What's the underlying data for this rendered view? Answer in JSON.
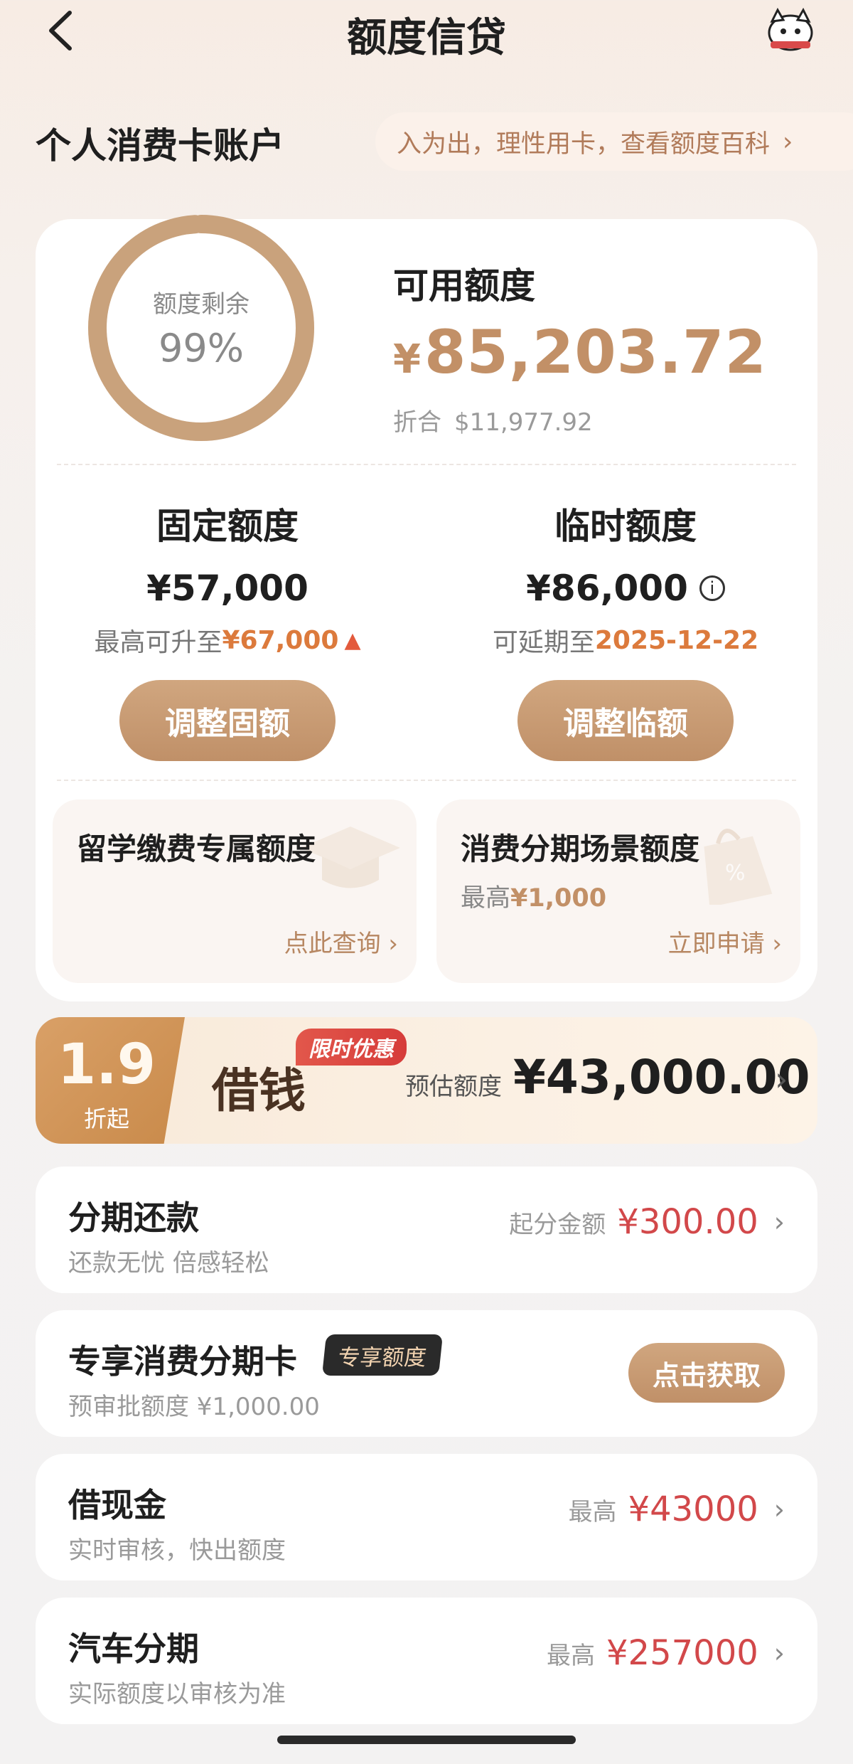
{
  "header": {
    "title": "额度信贷"
  },
  "account": {
    "section_title": "个人消费卡账户",
    "tip": "入为出，理性用卡，查看额度百科",
    "ring": {
      "label": "额度剩余",
      "value": "99%",
      "fraction": 0.99
    },
    "available": {
      "title": "可用额度",
      "currency": "¥",
      "amount": "85,203.72",
      "usd_label": "折合",
      "usd_amount": "$11,977.92"
    },
    "fixed": {
      "title": "固定额度",
      "amount": "¥57,000",
      "sub_prefix": "最高可升至",
      "sub_value": "¥67,000",
      "button": "调整固额"
    },
    "temporary": {
      "title": "临时额度",
      "amount": "¥86,000",
      "sub_prefix": "可延期至",
      "sub_value": "2025-12-22",
      "button": "调整临额"
    },
    "study": {
      "title": "留学缴费专属额度",
      "link": "点此查询"
    },
    "installment_scene": {
      "title": "消费分期场景额度",
      "sub_prefix": "最高",
      "sub_value": "¥1,000",
      "link": "立即申请"
    }
  },
  "loan_banner": {
    "rate": "1.9",
    "rate_sub": "折起",
    "title": "借钱",
    "tag": "限时优惠",
    "est_label": "预估额度",
    "amount": "¥43,000.00"
  },
  "rows": [
    {
      "title": "分期还款",
      "sub": "还款无忧 倍感轻松",
      "right_label": "起分金额",
      "right_value": "¥300.00"
    },
    {
      "title": "专享消费分期卡",
      "tag": "专享额度",
      "sub": "预审批额度 ¥1,000.00",
      "button": "点击获取"
    },
    {
      "title": "借现金",
      "sub": "实时审核，快出额度",
      "right_label": "最高",
      "right_value": "¥43000"
    },
    {
      "title": "汽车分期",
      "sub": "实际额度以审核为准",
      "right_label": "最高",
      "right_value": "¥257000"
    }
  ],
  "colors": {
    "accent": "#c29067",
    "highlight": "#dc7a3c",
    "red": "#d2484a"
  },
  "icons": {
    "back": "chevron-left-icon",
    "mascot": "mascot-icon",
    "info": "info-icon",
    "up": "arrow-up-icon",
    "chevron": "chevron-right-icon"
  }
}
